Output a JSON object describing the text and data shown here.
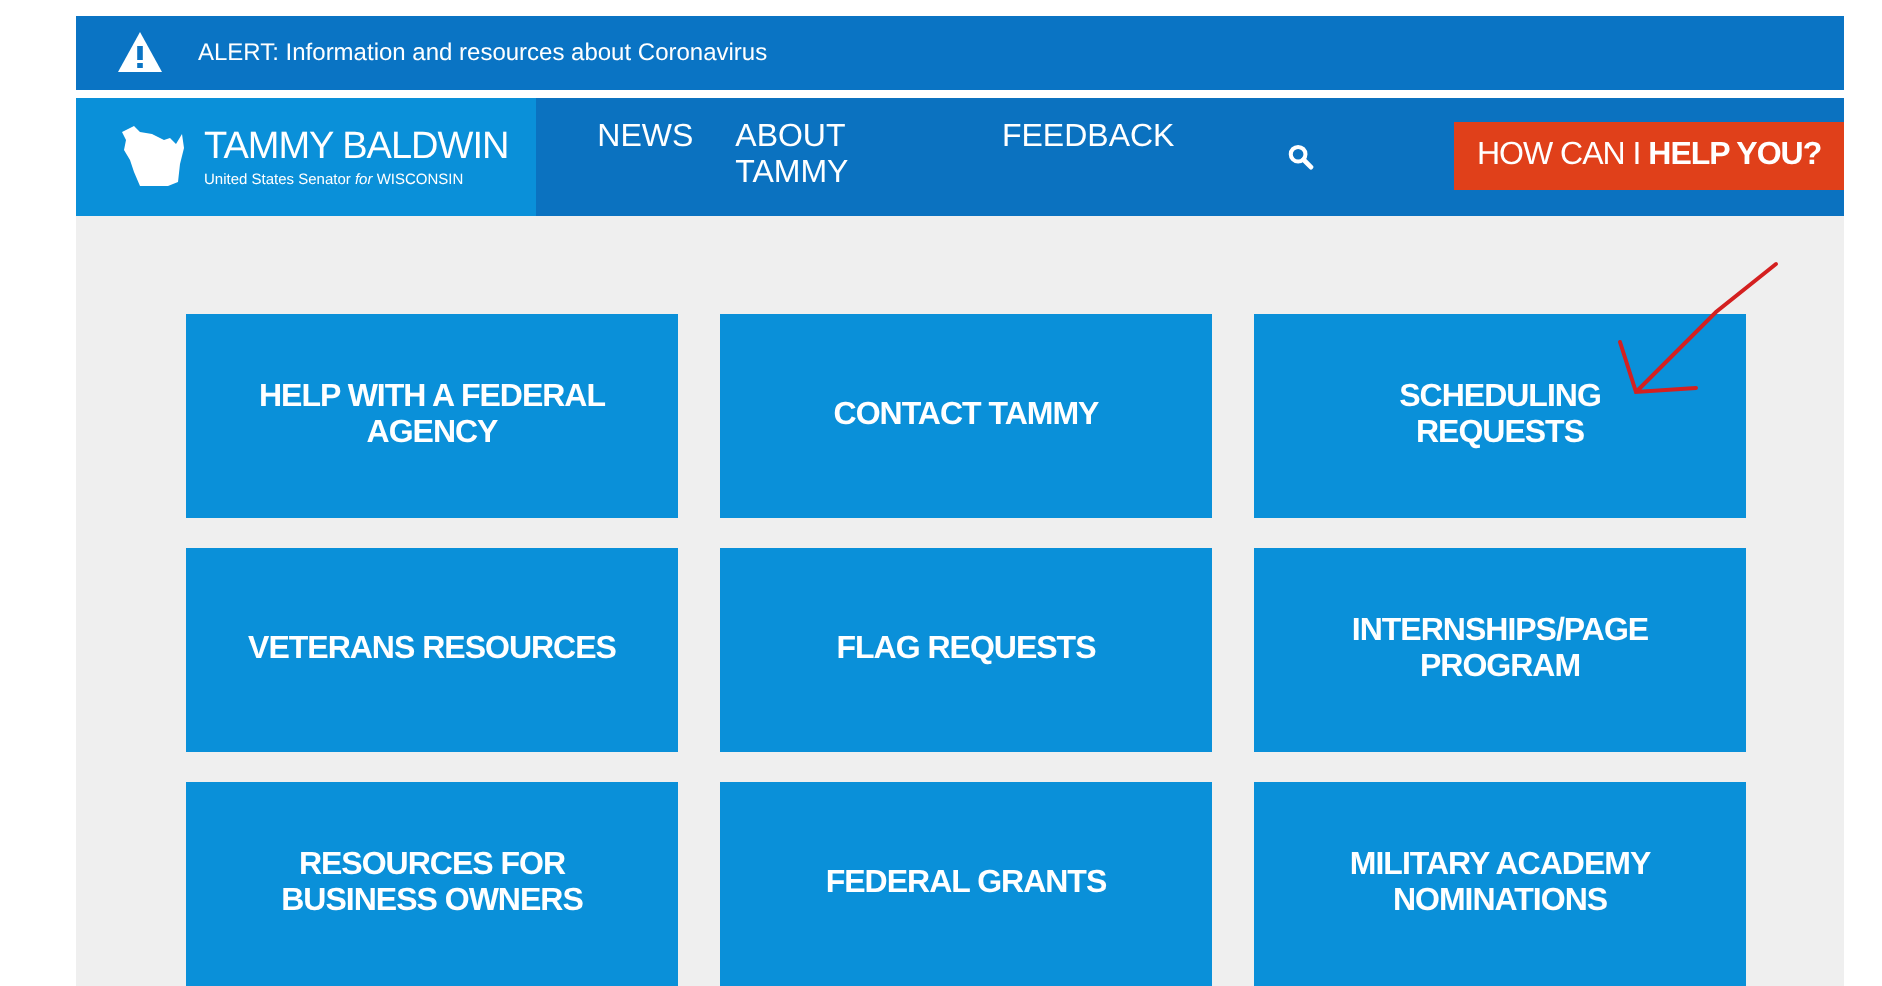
{
  "alert": {
    "text": "ALERT: Information and resources about Coronavirus"
  },
  "logo": {
    "name": "TAMMY BALDWIN",
    "subtitle": "United States Senator *for* WISCONSIN"
  },
  "nav": [
    {
      "label": "NEWS"
    },
    {
      "label": "ABOUT TAMMY"
    },
    {
      "label": "FEEDBACK"
    }
  ],
  "help_button": {
    "text": "HOW CAN I",
    "bold": "HELP YOU?"
  },
  "tiles": [
    {
      "label": "HELP WITH A FEDERAL AGENCY"
    },
    {
      "label": "CONTACT TAMMY"
    },
    {
      "label": "SCHEDULING REQUESTS"
    },
    {
      "label": "VETERANS RESOURCES"
    },
    {
      "label": "FLAG REQUESTS"
    },
    {
      "label": "INTERNSHIPS/PAGE PROGRAM"
    },
    {
      "label": "RESOURCES FOR BUSINESS OWNERS"
    },
    {
      "label": "FEDERAL GRANTS"
    },
    {
      "label": "MILITARY ACADEMY NOMINATIONS"
    }
  ]
}
